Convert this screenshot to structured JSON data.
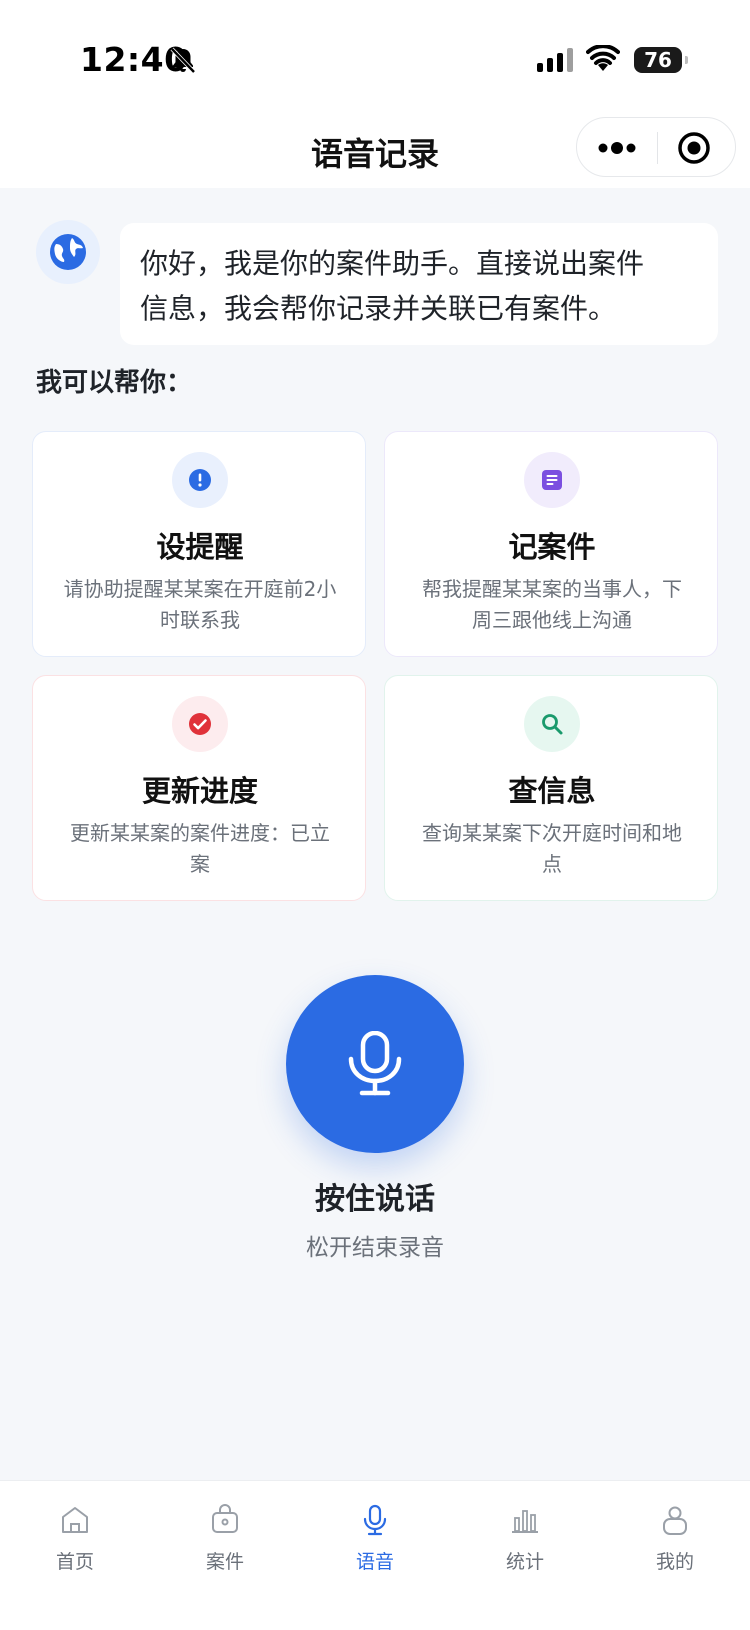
{
  "status_bar": {
    "time": "12:40",
    "battery": "76"
  },
  "nav": {
    "title": "语音记录"
  },
  "assistant": {
    "greeting_line1": "你好，我是你的案件助手。直接说出案件",
    "greeting_line2": "信息，我会帮你记录并关联已有案件。"
  },
  "section_label": "我可以帮你：",
  "cards": [
    {
      "title": "设提醒",
      "desc_line1": "请协助提醒某某案在开庭前2小",
      "desc_line2": "时联系我",
      "icon": "alert-icon",
      "color": "#2b6be3"
    },
    {
      "title": "记案件",
      "desc_line1": "帮我提醒某某案的当事人，下",
      "desc_line2": "周三跟他线上沟通",
      "icon": "document-icon",
      "color": "#7b4fe0"
    },
    {
      "title": "更新进度",
      "desc_line1": "更新某某案的案件进度：已立",
      "desc_line2": "案",
      "icon": "check-icon",
      "color": "#e0323a"
    },
    {
      "title": "查信息",
      "desc_line1": "查询某某案下次开庭时间和地",
      "desc_line2": "点",
      "icon": "search-icon",
      "color": "#1a9a6c"
    }
  ],
  "record": {
    "label": "按住说话",
    "hint": "松开结束录音"
  },
  "tabbar": {
    "items": [
      {
        "label": "首页",
        "icon": "home-icon"
      },
      {
        "label": "案件",
        "icon": "briefcase-icon"
      },
      {
        "label": "语音",
        "icon": "microphone-icon"
      },
      {
        "label": "统计",
        "icon": "bar-chart-icon"
      },
      {
        "label": "我的",
        "icon": "user-icon"
      }
    ],
    "active_index": 2
  },
  "colors": {
    "accent": "#2b6be3",
    "background": "#f5f7fa",
    "muted_text": "#6b717a"
  }
}
